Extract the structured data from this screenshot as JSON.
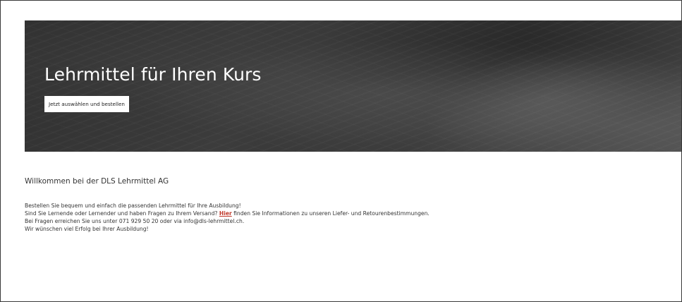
{
  "hero": {
    "title": "Lehrmittel für Ihren Kurs",
    "button_label": "Jetzt auswählen und bestellen"
  },
  "welcome": {
    "title": "Willkommen bei der DLS Lehrmittel AG",
    "line1": "Bestellen Sie bequem und einfach die passenden Lehrmittel für Ihre Ausbildung!",
    "line2_before": "Sind Sie Lernende oder Lernender und haben Fragen zu Ihrem Versand? ",
    "line2_link": "Hier",
    "line2_after": " finden Sie Informationen zu unseren Liefer- und Retourenbestimmungen.",
    "line3": "Bei Fragen erreichen Sie uns unter 071 929 50 20 oder via info@dls-lehrmittel.ch.",
    "line4": "Wir wünschen viel Erfolg bei Ihrer Ausbildung!"
  },
  "colors": {
    "link": "#c0392b",
    "hero_bg": "#3a3a3a",
    "text": "#333333"
  }
}
